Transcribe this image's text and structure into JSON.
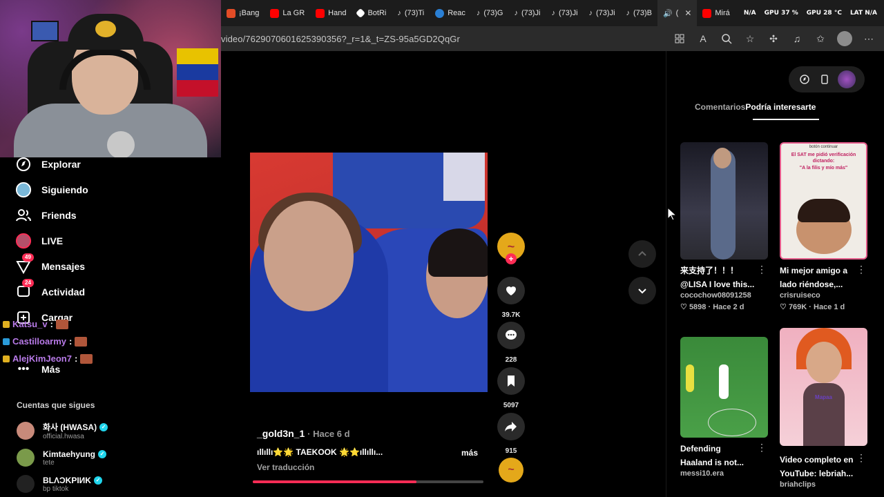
{
  "browser": {
    "tabs": [
      {
        "label": "¡Bang",
        "color": "#e34c26"
      },
      {
        "label": "La GR",
        "color": "#ff0000"
      },
      {
        "label": "Hand",
        "color": "#ff0000"
      },
      {
        "label": "BotRi",
        "color": "#ffffff"
      },
      {
        "label": "(73)Ti",
        "color": "#222222"
      },
      {
        "label": "Reac",
        "color": "#2a7fd4"
      },
      {
        "label": "(73)G",
        "color": "#222222"
      },
      {
        "label": "(73)Ji",
        "color": "#222222"
      },
      {
        "label": "(73)Ji",
        "color": "#222222"
      },
      {
        "label": "(73)Ji",
        "color": "#222222"
      },
      {
        "label": "(73)B",
        "color": "#222222"
      },
      {
        "label": "(",
        "color": "#222222",
        "active": true
      },
      {
        "label": "Mirá",
        "color": "#ff0000"
      }
    ],
    "stats": [
      "N/A",
      "GPU 37 %",
      "GPU 28 °C",
      "LAT N/A"
    ],
    "url": "video/7629070601625390356?_r=1&_t=ZS-95a5GD2QqGr"
  },
  "sidebar": {
    "items": [
      {
        "label": "Explorar",
        "icon": "compass-icon"
      },
      {
        "label": "Siguiendo",
        "icon": "following-icon"
      },
      {
        "label": "Friends",
        "icon": "friends-icon"
      },
      {
        "label": "LIVE",
        "icon": "live-icon"
      },
      {
        "label": "Mensajes",
        "icon": "messages-icon",
        "badge": "49"
      },
      {
        "label": "Actividad",
        "icon": "activity-icon",
        "badge": "24"
      },
      {
        "label": "Cargar",
        "icon": "upload-icon"
      },
      {
        "label": "Más",
        "icon": "more-icon"
      }
    ],
    "chat": [
      {
        "user": "Katsu_v",
        "color": "#b87ae8",
        "suffix": ":"
      },
      {
        "user": "Castilloarmy",
        "color": "#b87ae8",
        "suffix": ":"
      },
      {
        "user": "AlejKimJeon7",
        "color": "#b87ae8",
        "suffix": ":"
      }
    ],
    "following_title": "Cuentas que sigues",
    "accounts": [
      {
        "name": "화사 (HWASA)",
        "handle": "official.hwasa",
        "avatar": "#c88a7a"
      },
      {
        "name": "Kimtaehyung",
        "handle": "tete",
        "avatar": "#7a9a4a"
      },
      {
        "name": "BLΛƆKPIИK",
        "handle": "bp tiktok",
        "avatar": "#222222"
      }
    ]
  },
  "video": {
    "author": "_gold3n_1",
    "age": "· Hace 6 d",
    "caption": "ıllıllı⭐🌟 TAEKOOK 🌟⭐ıllıllı...",
    "more": "más",
    "translate": "Ver traducción",
    "progress": 0.71,
    "likes": "39.7K",
    "comments": "228",
    "saves": "5097",
    "shares": "915"
  },
  "panel": {
    "tab_comments": "Comentarios",
    "tab_interest": "Podría interesarte",
    "cards": [
      {
        "title1": "来支持了！！！",
        "title2": "@LISA I love this...",
        "user": "cocochow08091258",
        "likes": "5898",
        "age": "Hace 2 d"
      },
      {
        "title1": "Mi mejor amigo a",
        "title2": "lado riéndose,...",
        "user": "crisruiseco",
        "likes": "769K",
        "age": "Hace 1 d",
        "thumb_text1": "botón continuar",
        "thumb_text2": "El SAT me pidió verificación dictando:",
        "thumb_text3": "\"A la filis y mío más\""
      },
      {
        "title1": "Defending",
        "title2": "Haaland is not...",
        "user": "messi10.era"
      },
      {
        "title1": "Video completo en",
        "title2": "YouTube: lebriah...",
        "user": "briahclips",
        "thumb_text1": "Mapaa"
      }
    ]
  }
}
